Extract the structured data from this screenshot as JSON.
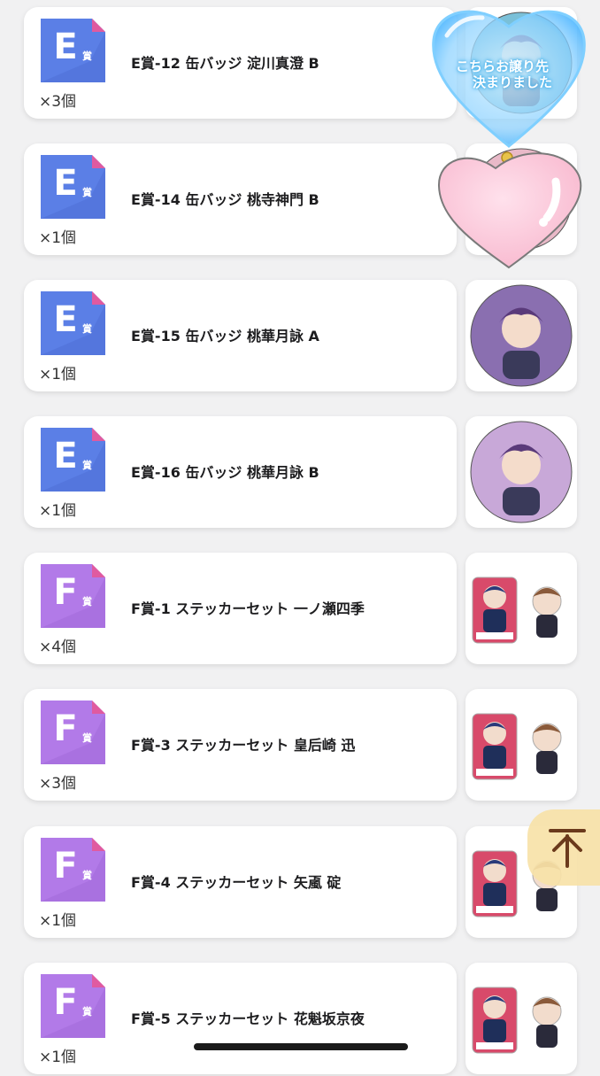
{
  "items": [
    {
      "grade": "E",
      "kanji": "賞",
      "title": "E賞-12 缶バッジ 淀川真澄 B",
      "qty": "×3個",
      "thumb": "badge"
    },
    {
      "grade": "E",
      "kanji": "賞",
      "title": "E賞-14 缶バッジ 桃寺神門 B",
      "qty": "×1個",
      "thumb": "badge"
    },
    {
      "grade": "E",
      "kanji": "賞",
      "title": "E賞-15 缶バッジ 桃華月詠 A",
      "qty": "×1個",
      "thumb": "badge"
    },
    {
      "grade": "E",
      "kanji": "賞",
      "title": "E賞-16 缶バッジ 桃華月詠 B",
      "qty": "×1個",
      "thumb": "badge"
    },
    {
      "grade": "F",
      "kanji": "賞",
      "title": "F賞-1 ステッカーセット 一ノ瀬四季",
      "qty": "×4個",
      "thumb": "sticker"
    },
    {
      "grade": "F",
      "kanji": "賞",
      "title": "F賞-3 ステッカーセット 皇后崎 迅",
      "qty": "×3個",
      "thumb": "sticker"
    },
    {
      "grade": "F",
      "kanji": "賞",
      "title": "F賞-4 ステッカーセット 矢颪 碇",
      "qty": "×1個",
      "thumb": "sticker"
    },
    {
      "grade": "F",
      "kanji": "賞",
      "title": "F賞-5 ステッカーセット 花魁坂京夜",
      "qty": "×1個",
      "thumb": "sticker"
    }
  ],
  "colors": {
    "E": "#5b7fe6",
    "E_dark": "#4f6fd6",
    "F": "#b27ae8",
    "F_dark": "#a36ad9",
    "corner": "#e05aa0"
  },
  "overlay": {
    "line1": "こちらお譲り先",
    "line2": "決まりました"
  },
  "icons": {
    "scroll_top": "arrow-up-to-top-icon"
  }
}
